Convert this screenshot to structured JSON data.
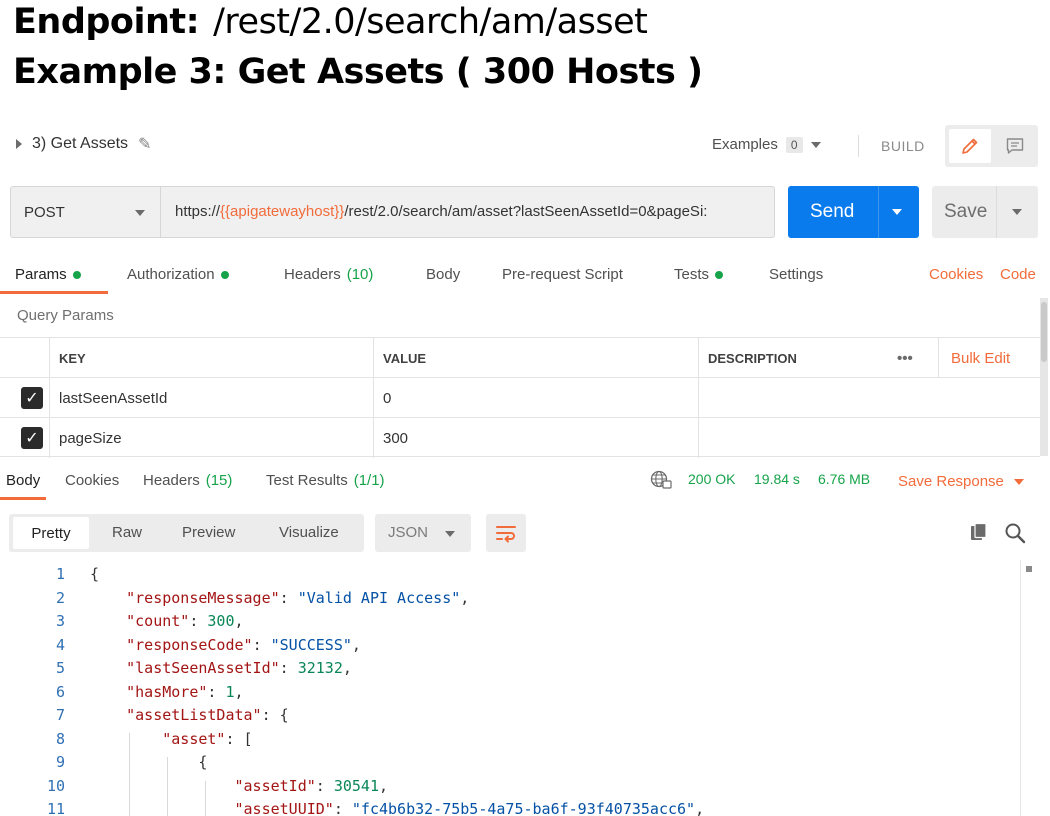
{
  "slide": {
    "endpoint_label": "Endpoint:",
    "endpoint_path": "/rest/2.0/search/am/asset",
    "example_title": "Example 3: Get Assets ( 300 Hosts )"
  },
  "request": {
    "name": "3) Get Assets",
    "examples_label": "Examples",
    "examples_count": "0",
    "build_label": "BUILD",
    "method": "POST",
    "url_prefix": "https://",
    "url_variable": "{{apigatewayhost}}",
    "url_suffix": "/rest/2.0/search/am/asset?lastSeenAssetId=0&pageSi:",
    "send_label": "Send",
    "save_label": "Save"
  },
  "request_tabs": [
    {
      "label": "Params",
      "dot": true
    },
    {
      "label": "Authorization",
      "dot": true
    },
    {
      "label": "Headers",
      "count": "(10)"
    },
    {
      "label": "Body"
    },
    {
      "label": "Pre-request Script"
    },
    {
      "label": "Tests",
      "dot": true
    },
    {
      "label": "Settings"
    }
  ],
  "request_links": {
    "cookies": "Cookies",
    "code": "Code"
  },
  "query_params": {
    "title": "Query Params",
    "headers": {
      "key": "KEY",
      "value": "VALUE",
      "description": "DESCRIPTION",
      "more": "•••",
      "bulk_edit": "Bulk Edit"
    },
    "rows": [
      {
        "key": "lastSeenAssetId",
        "value": "0",
        "description": "",
        "checked": true
      },
      {
        "key": "pageSize",
        "value": "300",
        "description": "",
        "checked": true
      }
    ]
  },
  "response_tabs": [
    {
      "label": "Body"
    },
    {
      "label": "Cookies"
    },
    {
      "label": "Headers",
      "count": "(15)"
    },
    {
      "label": "Test Results",
      "count": "(1/1)"
    }
  ],
  "response_status": {
    "status": "200 OK",
    "time": "19.84 s",
    "size": "6.76 MB",
    "save_response": "Save Response"
  },
  "format_tabs": [
    "Pretty",
    "Raw",
    "Preview",
    "Visualize"
  ],
  "language": "JSON",
  "code_lines": [
    {
      "n": "1",
      "t": "{"
    },
    {
      "n": "2",
      "t": "    \"responseMessage\": \"Valid API Access\","
    },
    {
      "n": "3",
      "t": "    \"count\": 300,"
    },
    {
      "n": "4",
      "t": "    \"responseCode\": \"SUCCESS\","
    },
    {
      "n": "5",
      "t": "    \"lastSeenAssetId\": 32132,"
    },
    {
      "n": "6",
      "t": "    \"hasMore\": 1,"
    },
    {
      "n": "7",
      "t": "    \"assetListData\": {"
    },
    {
      "n": "8",
      "t": "        \"asset\": ["
    },
    {
      "n": "9",
      "t": "            {"
    },
    {
      "n": "10",
      "t": "                \"assetId\": 30541,"
    },
    {
      "n": "11",
      "t": "                \"assetUUID\": \"fc4b6b32-75b5-4a75-ba6f-93f40735acc6\","
    }
  ],
  "colors": {
    "accent": "#f26b3a",
    "send": "#097bed",
    "success": "#16a34a"
  }
}
